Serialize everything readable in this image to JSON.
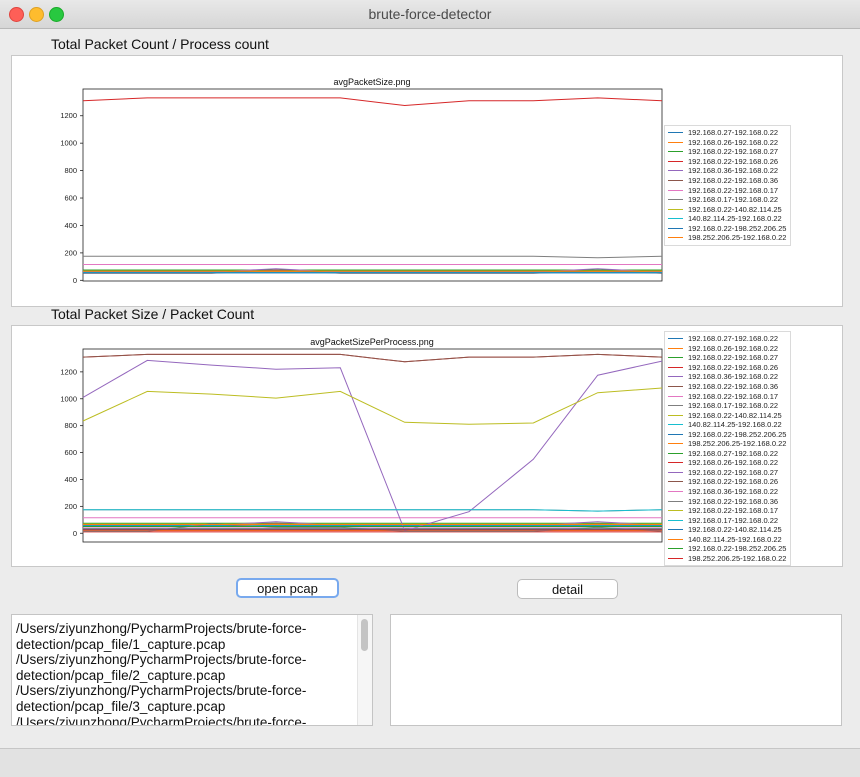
{
  "window": {
    "title": "brute-force-detector"
  },
  "sections": {
    "top_label": "Total Packet Count / Process count",
    "bottom_label": "Total Packet Size / Packet Count"
  },
  "colors": [
    "#1f77b4",
    "#ff7f0e",
    "#2ca02c",
    "#d62728",
    "#9467bd",
    "#8c564b",
    "#e377c2",
    "#7f7f7f",
    "#bcbd22",
    "#17becf"
  ],
  "chart_data": [
    {
      "type": "line",
      "title": "avgPacketSize.png",
      "xlim": [
        0,
        8
      ],
      "ylim": [
        -5,
        1395
      ],
      "yticks": [
        0,
        200,
        400,
        600,
        800,
        1000,
        1200
      ],
      "series": [
        {
          "name": "192.168.0.27-192.168.0.22",
          "values": [
            55,
            55,
            55,
            55,
            55,
            55,
            55,
            55,
            55
          ]
        },
        {
          "name": "192.168.0.26-192.168.0.22",
          "values": [
            62,
            62,
            62,
            62,
            62,
            62,
            62,
            62,
            62
          ]
        },
        {
          "name": "192.168.0.22-192.168.0.27",
          "values": [
            75,
            75,
            75,
            75,
            75,
            75,
            75,
            75,
            75
          ]
        },
        {
          "name": "192.168.0.22-192.168.0.26",
          "values": [
            1310,
            1330,
            1330,
            1330,
            1330,
            1275,
            1310,
            1310,
            1330,
            1310
          ]
        },
        {
          "name": "192.168.0.36-192.168.0.22",
          "values": [
            60,
            60,
            60,
            85,
            60,
            60,
            60,
            60,
            85,
            60
          ]
        },
        {
          "name": "192.168.0.22-192.168.0.36",
          "values": [
            52,
            52,
            52,
            75,
            52,
            52,
            52,
            52,
            70,
            52
          ]
        },
        {
          "name": "192.168.0.22-192.168.0.17",
          "values": [
            115,
            115,
            115,
            115,
            115,
            115,
            115,
            115,
            115,
            115
          ]
        },
        {
          "name": "192.168.0.17-192.168.0.22",
          "values": [
            175,
            175,
            175,
            175,
            175,
            175,
            175,
            175,
            165,
            175
          ]
        },
        {
          "name": "192.168.0.22-140.82.114.25",
          "values": [
            68,
            68,
            68,
            68,
            68,
            68,
            68,
            68,
            68,
            68
          ]
        },
        {
          "name": "140.82.114.25-192.168.0.22",
          "values": [
            58,
            58,
            58,
            58,
            58,
            58,
            58,
            58,
            58,
            58
          ]
        },
        {
          "name": "192.168.0.22-198.252.206.25",
          "values": [
            54,
            54,
            54,
            54,
            54,
            54,
            54,
            54,
            54,
            54
          ]
        },
        {
          "name": "198.252.206.25-192.168.0.22",
          "values": [
            66,
            66,
            66,
            66,
            66,
            66,
            66,
            66,
            66,
            66
          ]
        }
      ]
    },
    {
      "type": "line",
      "title": "avgPacketSizePerProcess.png",
      "xlim": [
        0,
        8
      ],
      "ylim": [
        -65,
        1370
      ],
      "yticks": [
        0,
        200,
        400,
        600,
        800,
        1000,
        1200
      ],
      "series": [
        {
          "name": "192.168.0.27-192.168.0.22",
          "values": [
            55,
            55,
            55,
            55,
            55,
            55,
            55,
            55,
            55
          ]
        },
        {
          "name": "192.168.0.26-192.168.0.22",
          "values": [
            62,
            62,
            62,
            62,
            62,
            62,
            62,
            62,
            62
          ]
        },
        {
          "name": "192.168.0.22-192.168.0.27",
          "values": [
            75,
            75,
            75,
            75,
            75,
            75,
            75,
            75,
            75
          ]
        },
        {
          "name": "192.168.0.22-192.168.0.26",
          "values": [
            1310,
            1330,
            1330,
            1330,
            1330,
            1275,
            1310,
            1310,
            1330,
            1310
          ]
        },
        {
          "name": "192.168.0.36-192.168.0.22",
          "values": [
            60,
            60,
            60,
            85,
            60,
            60,
            60,
            60,
            85,
            60
          ]
        },
        {
          "name": "192.168.0.22-192.168.0.36",
          "values": [
            52,
            52,
            52,
            75,
            52,
            52,
            52,
            52,
            70,
            52
          ]
        },
        {
          "name": "192.168.0.22-192.168.0.17",
          "values": [
            115,
            115,
            115,
            115,
            115,
            115,
            115,
            115,
            115,
            115
          ]
        },
        {
          "name": "192.168.0.17-192.168.0.22",
          "values": [
            175,
            175,
            175,
            175,
            175,
            175,
            175,
            175,
            165,
            175
          ]
        },
        {
          "name": "192.168.0.22-140.82.114.25",
          "values": [
            68,
            68,
            68,
            68,
            68,
            68,
            68,
            68,
            68,
            68
          ]
        },
        {
          "name": "140.82.114.25-192.168.0.22",
          "values": [
            58,
            58,
            58,
            58,
            58,
            58,
            58,
            58,
            58,
            58
          ]
        },
        {
          "name": "192.168.0.22-198.252.206.25",
          "values": [
            54,
            54,
            54,
            54,
            54,
            54,
            54,
            54,
            54,
            54
          ]
        },
        {
          "name": "198.252.206.25-192.168.0.22",
          "values": [
            20,
            20,
            20,
            20,
            20,
            20,
            20,
            20,
            20,
            20
          ]
        },
        {
          "name": "192.168.0.27-192.168.0.22",
          "values": [
            35,
            35,
            35,
            35,
            35,
            35,
            35,
            35,
            35,
            35
          ]
        },
        {
          "name": "192.168.0.26-192.168.0.22",
          "values": [
            10,
            10,
            10,
            10,
            10,
            10,
            10,
            10,
            10,
            10
          ]
        },
        {
          "name": "192.168.0.22-192.168.0.27",
          "values": [
            1010,
            1285,
            1250,
            1220,
            1230,
            20,
            160,
            550,
            1175,
            1280
          ]
        },
        {
          "name": "192.168.0.22-192.168.0.26",
          "values": [
            1310,
            1330,
            1330,
            1330,
            1330,
            1275,
            1310,
            1310,
            1330,
            1310
          ]
        },
        {
          "name": "192.168.0.36-192.168.0.22",
          "values": [
            40,
            40,
            40,
            40,
            40,
            40,
            40,
            40,
            40,
            40
          ]
        },
        {
          "name": "192.168.0.22-192.168.0.36",
          "values": [
            15,
            15,
            70,
            45,
            45,
            15,
            15,
            15,
            45,
            15
          ]
        },
        {
          "name": "192.168.0.22-192.168.0.17",
          "values": [
            835,
            1055,
            1035,
            1005,
            1055,
            825,
            810,
            820,
            1045,
            1080
          ]
        },
        {
          "name": "192.168.0.17-192.168.0.22",
          "values": [
            175,
            175,
            175,
            175,
            175,
            175,
            175,
            175,
            165,
            175
          ]
        },
        {
          "name": "192.168.0.22-140.82.114.25",
          "values": [
            30,
            30,
            30,
            30,
            30,
            30,
            30,
            30,
            30,
            30
          ]
        },
        {
          "name": "140.82.114.25-192.168.0.22",
          "values": [
            65,
            65,
            65,
            65,
            65,
            65,
            65,
            65,
            65,
            65
          ]
        },
        {
          "name": "192.168.0.22-198.252.206.25",
          "values": [
            50,
            50,
            50,
            50,
            50,
            50,
            50,
            50,
            50,
            50
          ]
        },
        {
          "name": "198.252.206.25-192.168.0.22",
          "values": [
            25,
            25,
            25,
            25,
            25,
            25,
            25,
            25,
            25,
            25
          ]
        }
      ]
    }
  ],
  "buttons": {
    "open_pcap": "open pcap",
    "detail": "detail"
  },
  "file_list": {
    "lines": [
      "/Users/ziyunzhong/PycharmProjects/brute-force-",
      "detection/pcap_file/1_capture.pcap",
      "/Users/ziyunzhong/PycharmProjects/brute-force-",
      "detection/pcap_file/2_capture.pcap",
      "/Users/ziyunzhong/PycharmProjects/brute-force-",
      "detection/pcap_file/3_capture.pcap",
      "/Users/ziyunzhong/PycharmProjects/brute-force-"
    ]
  }
}
